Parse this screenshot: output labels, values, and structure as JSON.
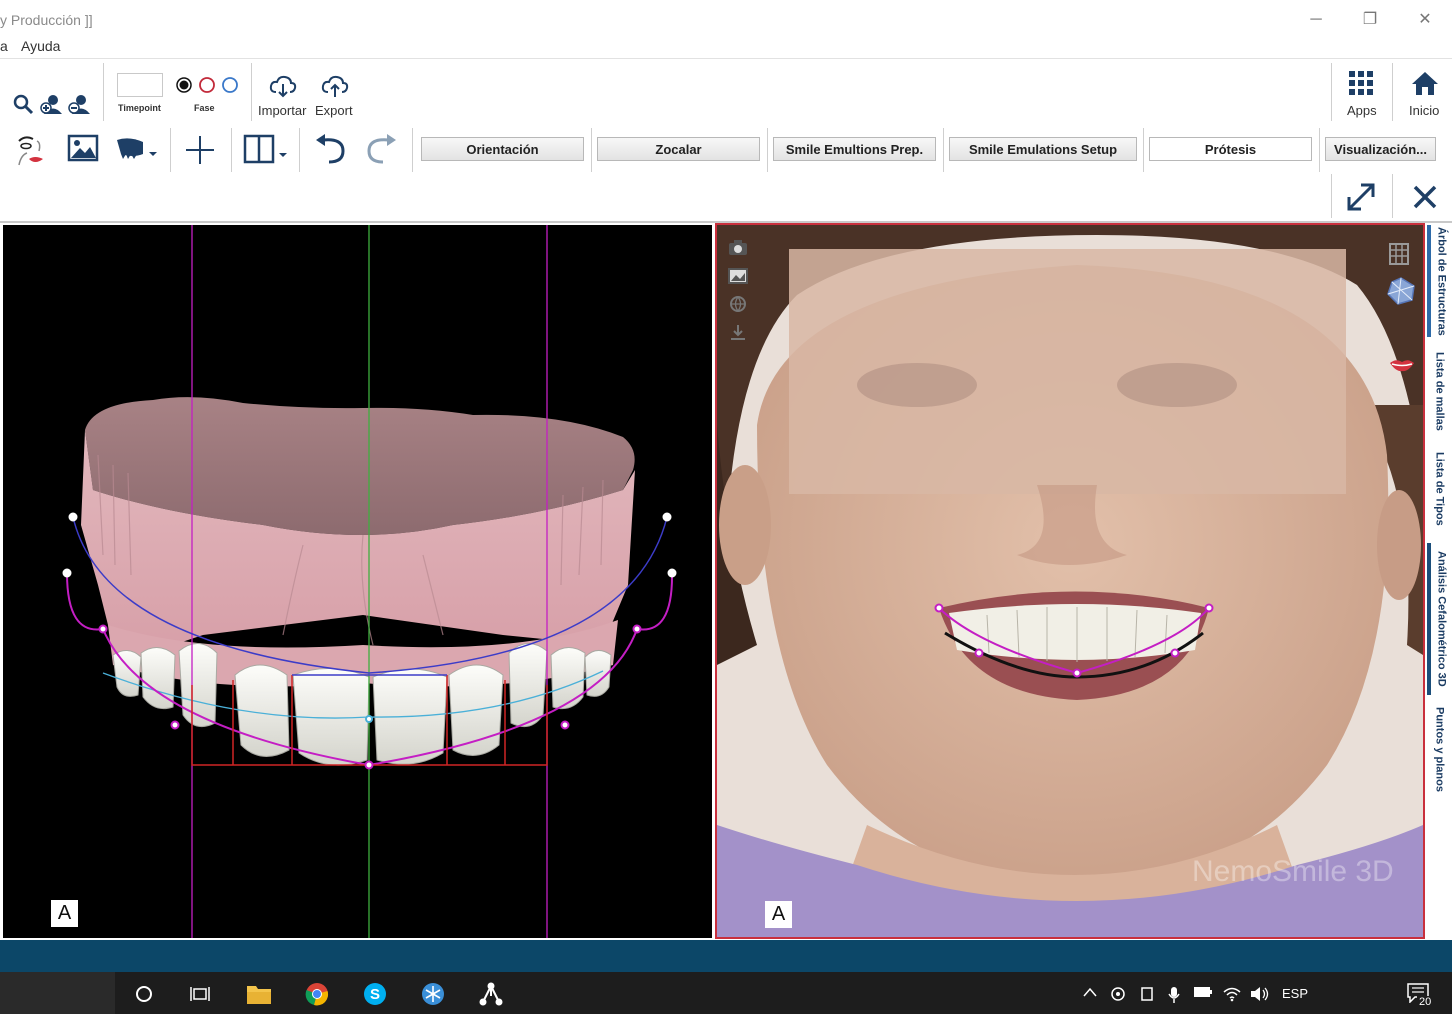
{
  "window": {
    "title": "y Producción ]]",
    "controls": {
      "minimize": "─",
      "restore": "❐",
      "close": "✕"
    }
  },
  "menu": {
    "items": [
      "a",
      "Ayuda"
    ]
  },
  "toolbar": {
    "timepoint_label": "Timepoint",
    "fase_label": "Fase",
    "import_label": "Importar",
    "export_label": "Export",
    "apps_label": "Apps",
    "home_label": "Inicio"
  },
  "workflow": {
    "buttons": [
      "Orientación",
      "Zocalar",
      "Smile Emultions Prep.",
      "Smile Emulations Setup",
      "Prótesis",
      "Visualización..."
    ],
    "active": "Prótesis"
  },
  "views": {
    "left_label": "A",
    "right_label": "A",
    "watermark": "NemoSmile 3D"
  },
  "side_tabs": [
    "Árbol de Estructuras",
    "Lista de mallas",
    "Lista de Tipos",
    "Análisis Cefalométrico 3D",
    "Puntos y planos"
  ],
  "side_tab_active": "Análisis Cefalométrico 3D",
  "taskbar": {
    "language": "ESP",
    "notification_count": "20"
  },
  "colors": {
    "status_bar": "#0c4768",
    "taskbar": "#1d1d1d",
    "active_view_border": "#c9303d",
    "guide_line": "#c41ec4",
    "midline": "#3fae3f",
    "arch_curve": "#3c3cc8",
    "gum": "#d9a9b0"
  }
}
